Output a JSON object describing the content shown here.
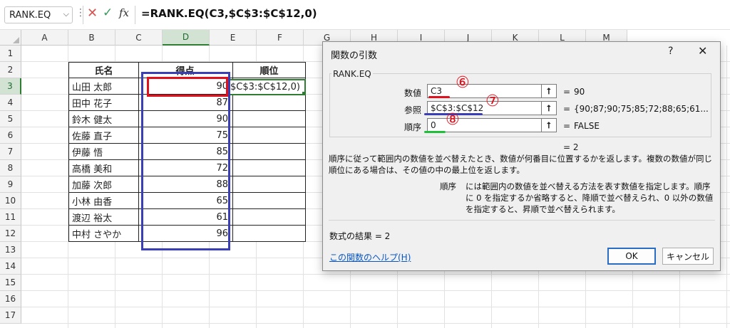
{
  "formula_bar": {
    "name_box": "RANK.EQ",
    "formula": "=RANK.EQ(C3,$C$3:$C$12,0)"
  },
  "columns": [
    "A",
    "B",
    "C",
    "D",
    "E",
    "F",
    "G",
    "H",
    "I",
    "J",
    "K",
    "L",
    "M"
  ],
  "rows": [
    "1",
    "2",
    "3",
    "4",
    "5",
    "6",
    "7",
    "8",
    "9",
    "10",
    "11",
    "12",
    "13",
    "14",
    "15",
    "16",
    "17"
  ],
  "table": {
    "headers": {
      "name": "氏名",
      "score": "得点",
      "rank": "順位"
    },
    "rows": [
      {
        "name": "山田 太郎",
        "score": "90"
      },
      {
        "name": "田中 花子",
        "score": "87"
      },
      {
        "name": "鈴木 健太",
        "score": "90"
      },
      {
        "name": "佐藤 直子",
        "score": "75"
      },
      {
        "name": "伊藤 悟",
        "score": "85"
      },
      {
        "name": "高橋 美和",
        "score": "72"
      },
      {
        "name": "加藤 次郎",
        "score": "88"
      },
      {
        "name": "小林 由香",
        "score": "65"
      },
      {
        "name": "渡辺 裕太",
        "score": "61"
      },
      {
        "name": "中村 さやか",
        "score": "96"
      }
    ],
    "active_cell_text": "$C$3:$C$12,0)"
  },
  "dialog": {
    "title": "関数の引数",
    "help": "?",
    "close": "✕",
    "function_name": "RANK.EQ",
    "args": [
      {
        "label": "数値",
        "value": "C3",
        "result": "90",
        "marker": "⑥",
        "underline_color": "#e0101c"
      },
      {
        "label": "参照",
        "value": "$C$3:$C$12",
        "result": "{90;87;90;75;85;72;88;65;61...",
        "marker": "⑦",
        "underline_color": "#3a3fb5"
      },
      {
        "label": "順序",
        "value": "0",
        "result": "FALSE",
        "marker": "⑧",
        "underline_color": "#1fbf3a"
      }
    ],
    "formula_result_eq": "=  2",
    "description": "順序に従って範囲内の数値を並べ替えたとき、数値が何番目に位置するかを返します。複数の数値が同じ順位にある場合は、その値の中の最上位を返します。",
    "arg_name": "順序",
    "arg_description": "には範囲内の数値を並べ替える方法を表す数値を指定します。順序に 0 を指定するか省略すると、降順で並べ替えられ、0 以外の数値を指定すると、昇順で並べ替えられます。",
    "result_label": "数式の結果 =  2",
    "help_link": "この関数のヘルプ(H)",
    "ok": "OK",
    "cancel": "キャンセル"
  }
}
